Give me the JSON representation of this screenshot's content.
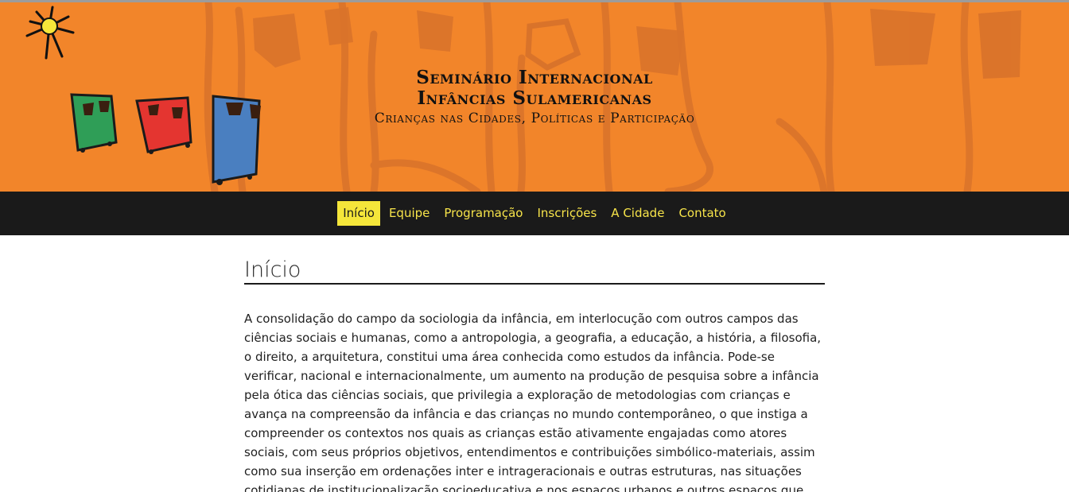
{
  "header": {
    "title_line1": "Seminário Internacional",
    "title_line2": "Infâncias Sulamericanas",
    "subtitle": "Crianças nas Cidades, Políticas e Participação",
    "colors": {
      "banner": "#f2852a",
      "nav_bg": "#1a1a1a",
      "nav_link": "#f7e44a",
      "nav_active_bg": "#f5e63a"
    },
    "decorations": [
      "sun-icon",
      "green-figure-icon",
      "red-figure-icon",
      "blue-figure-icon"
    ]
  },
  "nav": {
    "items": [
      {
        "label": "Início",
        "active": true
      },
      {
        "label": "Equipe",
        "active": false
      },
      {
        "label": "Programação",
        "active": false
      },
      {
        "label": "Inscrições",
        "active": false
      },
      {
        "label": "A Cidade",
        "active": false
      },
      {
        "label": "Contato",
        "active": false
      }
    ]
  },
  "main": {
    "heading": "Início",
    "paragraph": "A consolidação do campo da sociologia da infância, em interlocução com outros campos das ciências sociais e humanas, como a antropologia, a geografia, a educação, a história, a filosofia, o direito, a arquitetura, constitui uma área conhecida como estudos da infância. Pode-se verificar, nacional e internacionalmente, um aumento na produção de pesquisa sobre a infância pela ótica das ciências sociais, que privilegia a exploração de metodologias com crianças e avança na compreensão da infância e das crianças no mundo contemporâneo, o que instiga a compreender os contextos nos quais as crianças estão ativamente engajadas como atores sociais, com seus próprios objetivos, entendimentos e contribuições simbólico-materiais, assim como sua inserção em ordenações inter e intrageracionais e outras estruturas, nas situações cotidianas de institucionalização socioeducativa e nos espaços urbanos e outros espaços que"
  }
}
